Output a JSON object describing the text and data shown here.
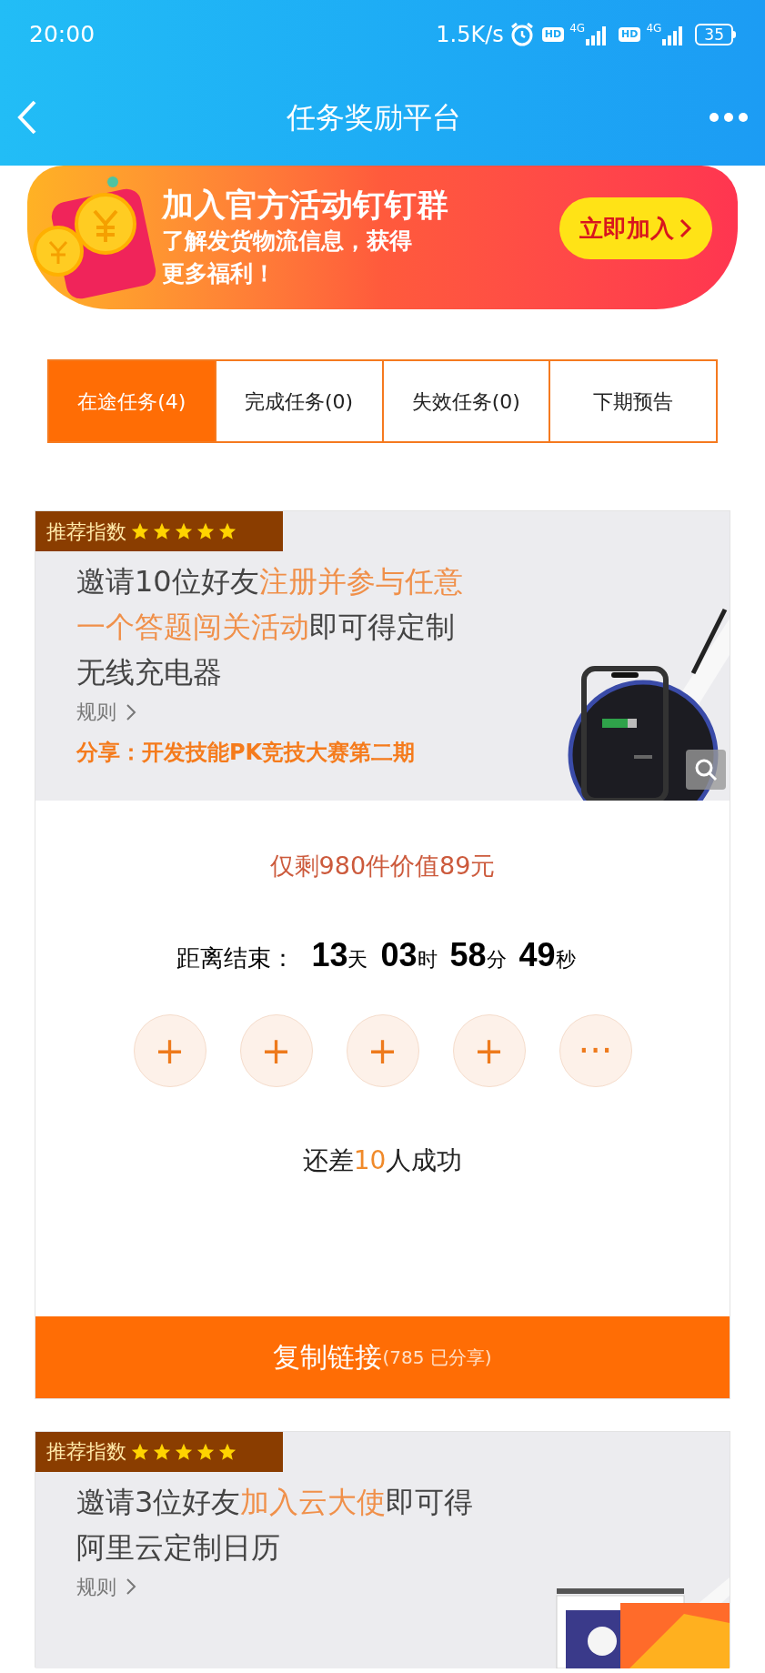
{
  "status_bar": {
    "time": "20:00",
    "speed": "1.5K/s",
    "sims": [
      {
        "hd": "HD",
        "network": "4G"
      },
      {
        "hd": "HD",
        "network": "4G"
      }
    ],
    "battery": "35"
  },
  "header": {
    "title": "任务奖励平台"
  },
  "banner": {
    "headline": "加入官方活动钉钉群",
    "text": "了解发货物流信息，获得更多福利！",
    "button": "立即加入"
  },
  "tabs": [
    {
      "label": "在途任务(4)",
      "selected": true
    },
    {
      "label": "完成任务(0)",
      "selected": false
    },
    {
      "label": "失效任务(0)",
      "selected": false
    },
    {
      "label": "下期预告",
      "selected": false
    }
  ],
  "tasks": [
    {
      "badge": "推荐指数",
      "stars": 5,
      "title": [
        {
          "text": "邀请10位好友",
          "highlight": false
        },
        {
          "text": "注册并参与任意一个答题闯关活动",
          "highlight": true
        },
        {
          "text": "即可得定制无线充电器",
          "highlight": false
        }
      ],
      "rules": "规则",
      "share": "分享：开发技能PK竞技大赛第二期",
      "stock": "仅剩980件价值89元",
      "countdown": {
        "label": "距离结束：",
        "parts": [
          {
            "value": "13",
            "unit": "天"
          },
          {
            "value": "03",
            "unit": "时"
          },
          {
            "value": "58",
            "unit": "分"
          },
          {
            "value": "49",
            "unit": "秒"
          }
        ]
      },
      "slots": [
        {
          "symbol": "+"
        },
        {
          "symbol": "+"
        },
        {
          "symbol": "+"
        },
        {
          "symbol": "+"
        },
        {
          "symbol": "···"
        }
      ],
      "progress": [
        {
          "text": "还差",
          "highlight": false
        },
        {
          "text": "10",
          "highlight": true
        },
        {
          "text": "人成功",
          "highlight": false
        }
      ],
      "button": {
        "label": "复制链接",
        "count": "(785 已分享)"
      }
    },
    {
      "badge": "推荐指数",
      "stars": 5,
      "title": [
        {
          "text": "邀请3位好友",
          "highlight": false
        },
        {
          "text": "加入云大使",
          "highlight": true
        },
        {
          "text": "即可得阿里云定制日历",
          "highlight": false
        }
      ],
      "rules": "规则"
    }
  ]
}
